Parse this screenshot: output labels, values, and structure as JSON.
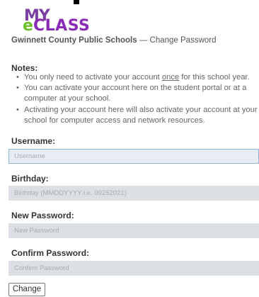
{
  "logo": {
    "my": "MY",
    "e": "e",
    "class": "CLASS"
  },
  "header": {
    "org": "Gwinnett County Public Schools",
    "dash": "—",
    "page": "Change Password"
  },
  "notes": {
    "title": "Notes:",
    "item1_pre": "You only need to activate your account ",
    "item1_u": "once",
    "item1_post": " for this school year.",
    "item2": "You can activate your account here on the student portal or at a computer at your school.",
    "item3": "Activating your account here will also activate your account at your school for computer access and network resources."
  },
  "form": {
    "username_label": "Username:",
    "username_placeholder": "Username",
    "birthday_label": "Birthday:",
    "birthday_placeholder": "Birthday (MMDDYYYY i.e. 09252021)",
    "new_password_label": "New Password:",
    "new_password_placeholder": "New Password",
    "confirm_password_label": "Confirm Password:",
    "confirm_password_placeholder": "Confirm Password",
    "submit_label": "Change"
  }
}
